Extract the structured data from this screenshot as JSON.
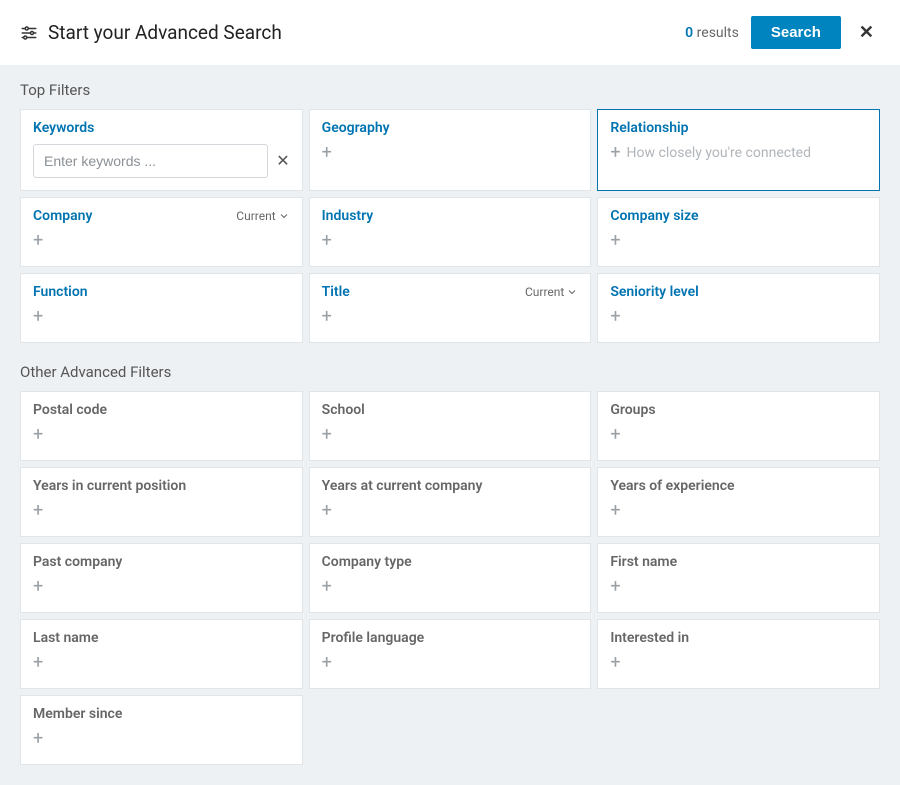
{
  "header": {
    "title": "Start your Advanced Search",
    "results_count": "0",
    "results_label": "results",
    "search_label": "Search"
  },
  "sections": {
    "top_label": "Top Filters",
    "other_label": "Other Advanced Filters"
  },
  "top": {
    "keywords": {
      "label": "Keywords",
      "placeholder": "Enter keywords ..."
    },
    "geography": {
      "label": "Geography"
    },
    "relationship": {
      "label": "Relationship",
      "hint": "How closely you're connected"
    },
    "company": {
      "label": "Company",
      "scope": "Current"
    },
    "industry": {
      "label": "Industry"
    },
    "company_size": {
      "label": "Company size"
    },
    "function": {
      "label": "Function"
    },
    "title": {
      "label": "Title",
      "scope": "Current"
    },
    "seniority": {
      "label": "Seniority level"
    }
  },
  "other": {
    "postal_code": {
      "label": "Postal code"
    },
    "school": {
      "label": "School"
    },
    "groups": {
      "label": "Groups"
    },
    "years_position": {
      "label": "Years in current position"
    },
    "years_company": {
      "label": "Years at current company"
    },
    "years_experience": {
      "label": "Years of experience"
    },
    "past_company": {
      "label": "Past company"
    },
    "company_type": {
      "label": "Company type"
    },
    "first_name": {
      "label": "First name"
    },
    "last_name": {
      "label": "Last name"
    },
    "profile_language": {
      "label": "Profile language"
    },
    "interested_in": {
      "label": "Interested in"
    },
    "member_since": {
      "label": "Member since"
    }
  }
}
